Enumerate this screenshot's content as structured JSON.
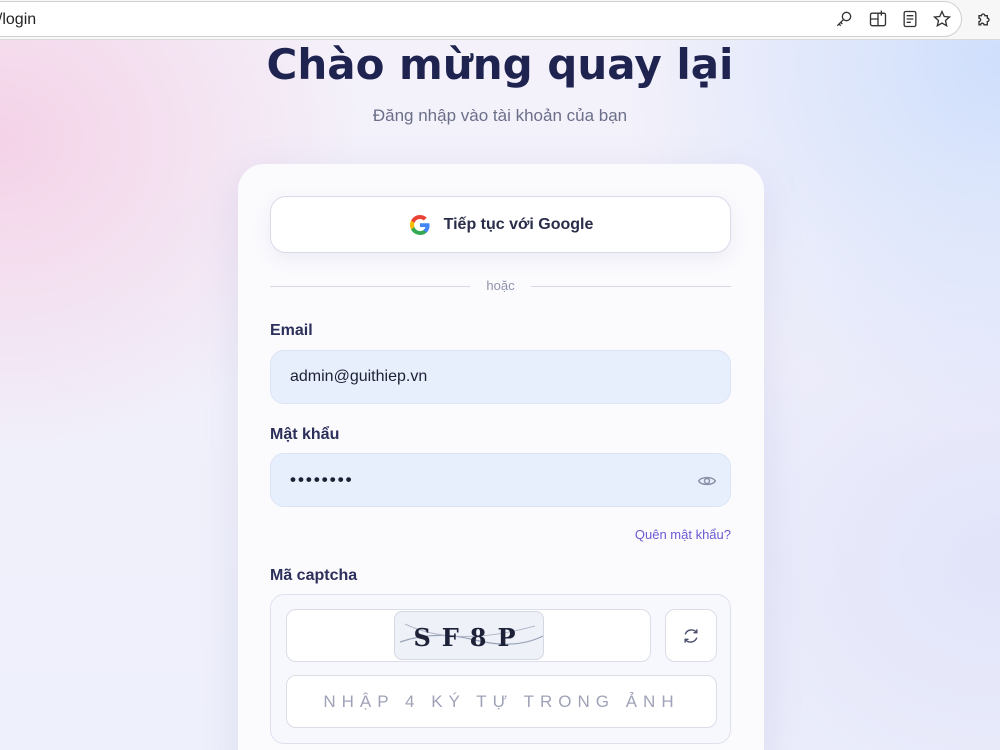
{
  "browser": {
    "url": "vn/login"
  },
  "header": {
    "title": "Chào mừng quay lại",
    "subtitle": "Đăng nhập vào tài khoản của bạn"
  },
  "login": {
    "google_label": "Tiếp tục với Google",
    "divider_text": "hoặc",
    "email_label": "Email",
    "email_value": "admin@guithiep.vn",
    "password_label": "Mật khẩu",
    "password_value": "••••••••",
    "forgot_label": "Quên mật khẩu?",
    "captcha_label": "Mã captcha",
    "captcha_code": "SF8P",
    "captcha_placeholder": "NHẬP 4 KÝ TỰ TRONG ẢNH"
  },
  "colors": {
    "title": "#1e2350",
    "accent_link": "#6a5ad2",
    "input_bg": "#e8effc"
  },
  "icons": [
    "key-icon",
    "split-screen-icon",
    "reader-icon",
    "star-icon",
    "extensions-icon",
    "google-icon",
    "eye-icon",
    "refresh-icon"
  ]
}
